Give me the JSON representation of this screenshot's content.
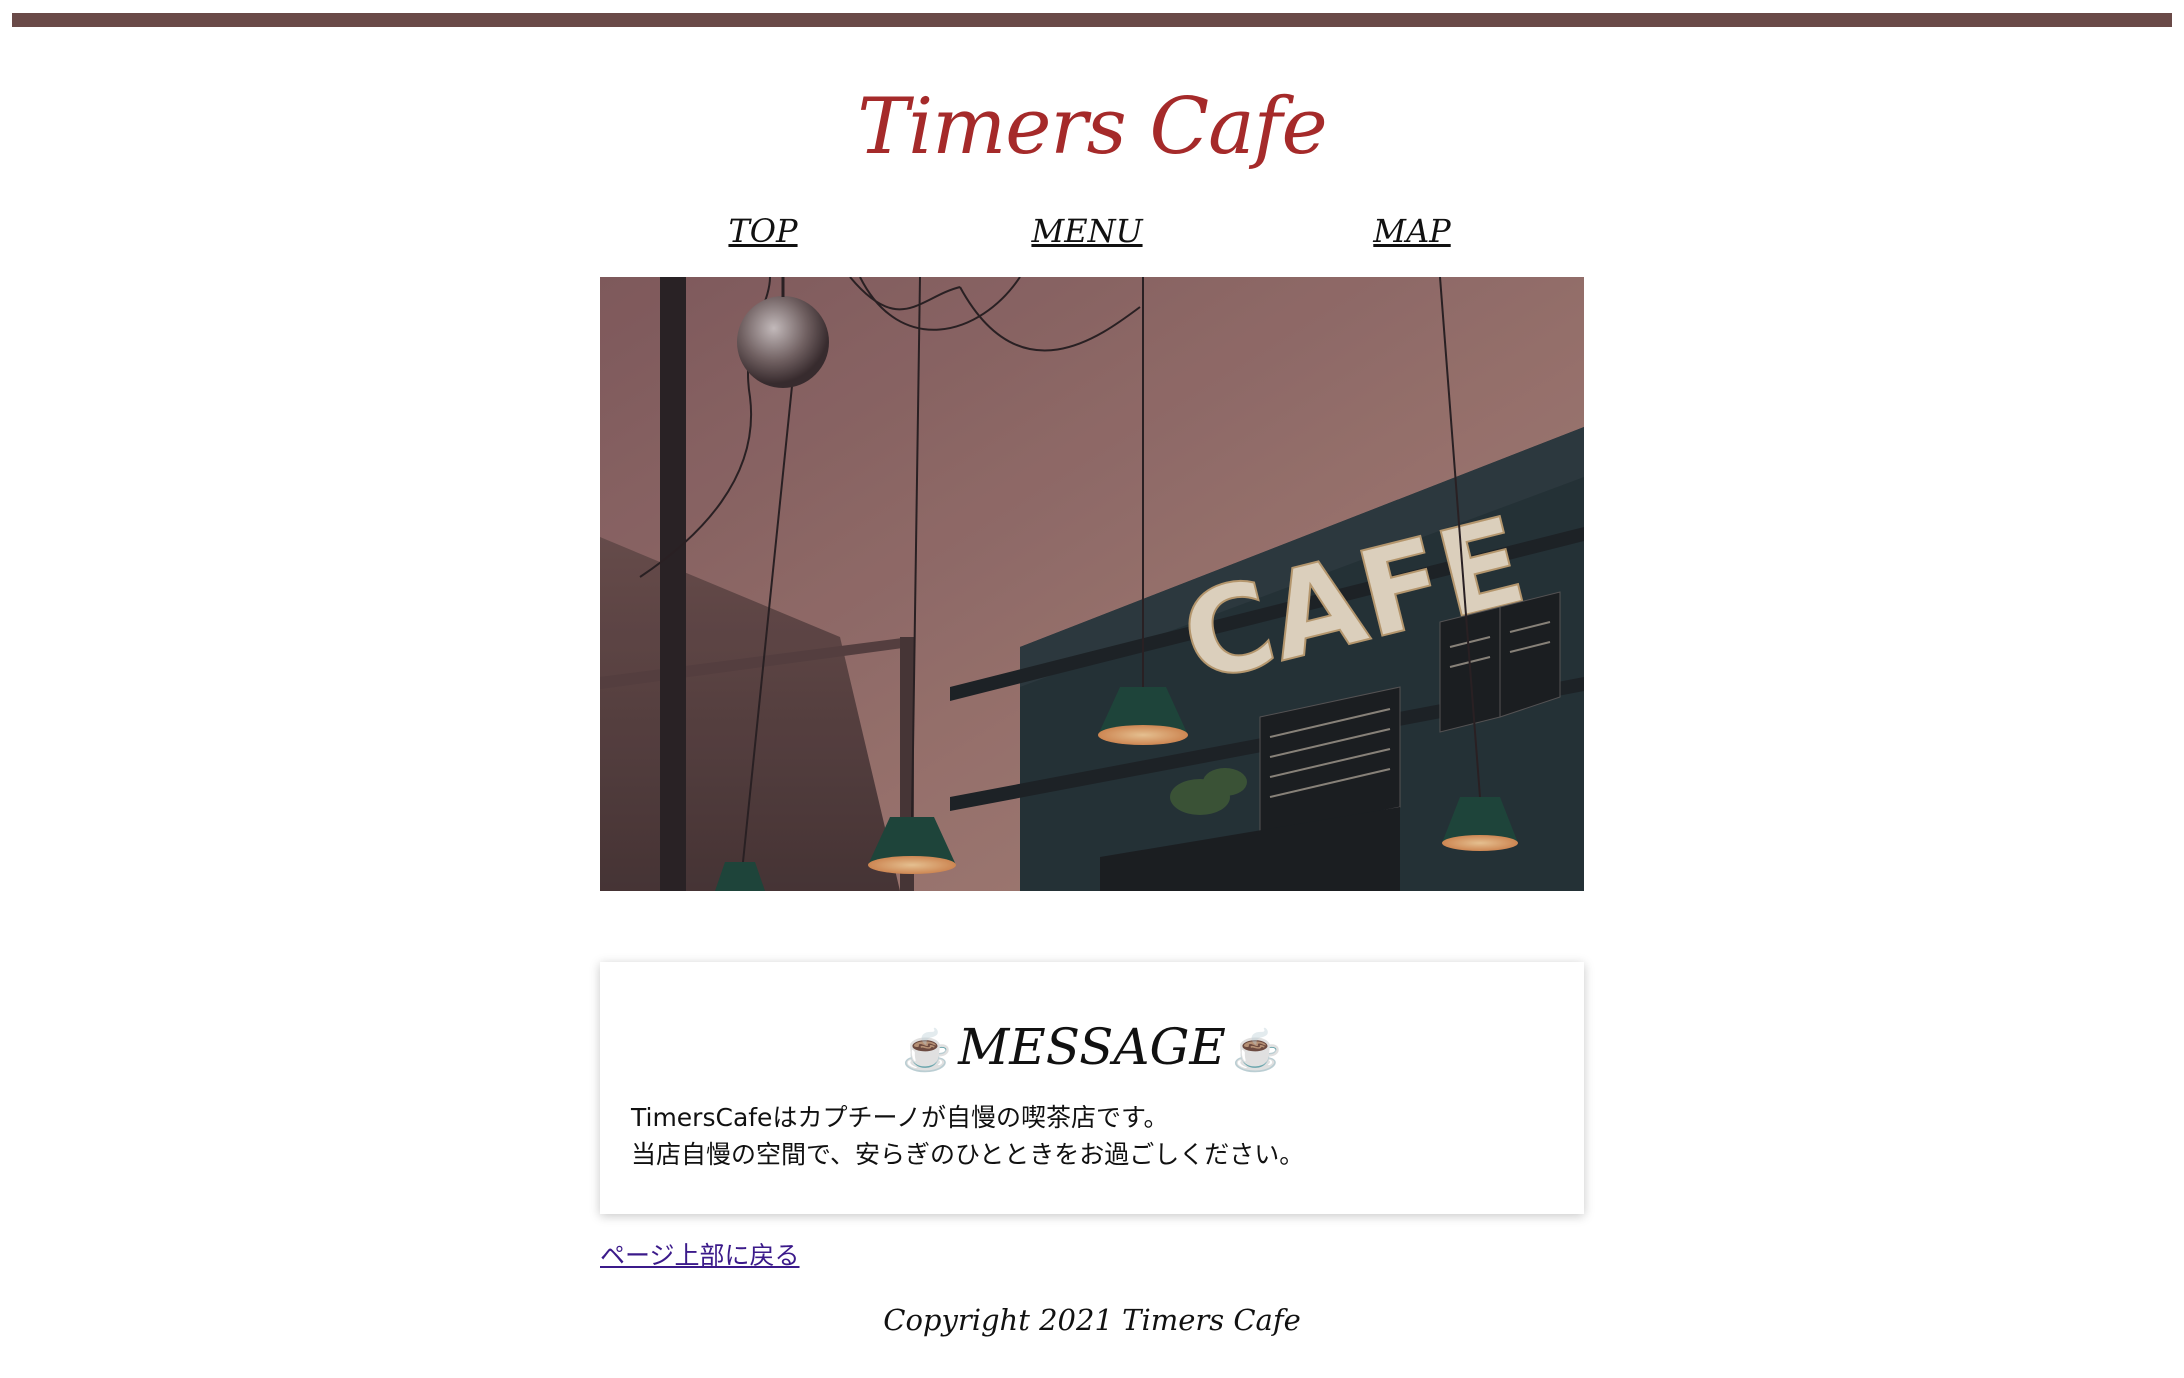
{
  "header": {
    "brand": "Timers Cafe"
  },
  "nav": {
    "items": [
      {
        "label": "TOP"
      },
      {
        "label": "MENU"
      },
      {
        "label": "MAP"
      }
    ]
  },
  "hero": {
    "sign_text": "CAFE"
  },
  "message": {
    "title": "MESSAGE",
    "title_icon": "coffee-cup-icon",
    "line1": "TimersCafeはカプチーノが自慢の喫茶店です。",
    "line2": "当店自慢の空間で、安らぎのひとときをお過ごしください。"
  },
  "footer": {
    "back_to_top": "ページ上部に戻る",
    "copyright": "Copyright 2021 Timers Cafe"
  },
  "colors": {
    "top_bar": "#6a4a48",
    "brand": "#a52a2a",
    "link_visited": "#3b1a8a"
  }
}
